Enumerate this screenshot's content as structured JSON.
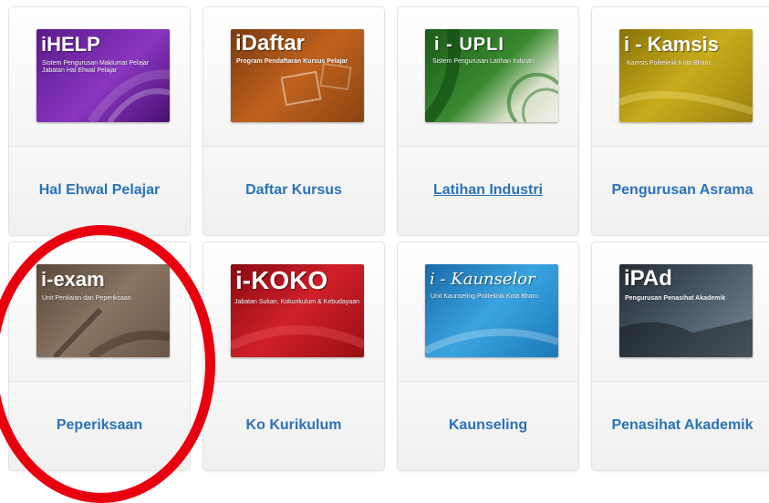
{
  "apps": [
    {
      "banner_title": "iHELP",
      "banner_subtitle": "Sistem Pengurusan Maklumat Pelajar\nJabatan Hal Ehwal Pelajar",
      "label": "Hal Ehwal Pelajar"
    },
    {
      "banner_title": "iDaftar",
      "banner_subtitle": "Program Pendaftaran Kursus Pelajar",
      "label": "Daftar Kursus"
    },
    {
      "banner_title": "i - UPLI",
      "banner_subtitle": "Sistem Pengurusan Latihan Industri",
      "label": "Latihan Industri"
    },
    {
      "banner_title": "i - Kamsis",
      "banner_subtitle": "Kamsis Politeknik Kota Bharu",
      "label": "Pengurusan Asrama"
    },
    {
      "banner_title": "i-exam",
      "banner_subtitle": "Unit Penilaian dan Peperiksaan",
      "label": "Peperiksaan"
    },
    {
      "banner_title": "i-KOKO",
      "banner_subtitle": "Jabatan Sukan, Kokurikulum & Kebudayaan",
      "label": "Ko Kurikulum"
    },
    {
      "banner_title": "i - Kaunselor",
      "banner_subtitle": "Unit Kaunseling Politeknik Kota Bharu",
      "label": "Kaunseling"
    },
    {
      "banner_title": "iPAd",
      "banner_subtitle": "Pengurusan Penasihat Akademik",
      "label": "Penasihat Akademik"
    }
  ],
  "colors": {
    "label_link": "#2a73b8",
    "highlight_circle": "#e8000f",
    "ihelp": "#7a2aa8",
    "idaftar": "#b8561a",
    "iupli": "#2f7a2a",
    "ikamsis": "#b49a12",
    "iexam": "#7a6450",
    "ikoko": "#c0141c",
    "ikaunselor": "#1f86c4",
    "ipad": "#33414e"
  },
  "highlight": {
    "target": "Peperiksaan"
  }
}
